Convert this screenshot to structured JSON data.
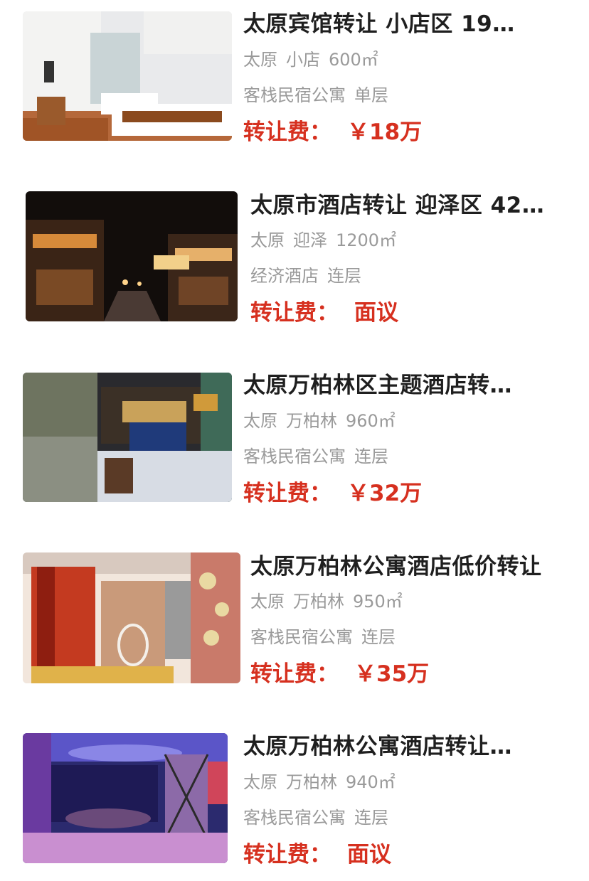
{
  "listings": [
    {
      "title": "太原宾馆转让 小店区 19…",
      "city": "太原",
      "district": "小店",
      "area": "600㎡",
      "category": "客栈民宿公寓",
      "floors": "单层",
      "price_label": "转让费：",
      "price": "￥18万",
      "thumb": "hotel-room-twin-beds"
    },
    {
      "title": "太原市酒店转让 迎泽区 42…",
      "city": "太原",
      "district": "迎泽",
      "area": "1200㎡",
      "category": "经济酒店",
      "floors": "连层",
      "price_label": "转让费：",
      "price": "面议",
      "thumb": "night-street-storefronts"
    },
    {
      "title": "太原万柏林区主题酒店转…",
      "city": "太原",
      "district": "万柏林",
      "area": "960㎡",
      "category": "客栈民宿公寓",
      "floors": "连层",
      "price_label": "转让费：",
      "price": "￥32万",
      "thumb": "theme-hotel-lobby"
    },
    {
      "title": "太原万柏林公寓酒店低价转让",
      "city": "太原",
      "district": "万柏林",
      "area": "950㎡",
      "category": "客栈民宿公寓",
      "floors": "连层",
      "price_label": "转让费：",
      "price": "￥35万",
      "thumb": "red-curtain-room-hanging-chair"
    },
    {
      "title": "太原万柏林公寓酒店转让…",
      "city": "太原",
      "district": "万柏林",
      "area": "940㎡",
      "category": "客栈民宿公寓",
      "floors": "连层",
      "price_label": "转让费：",
      "price": "面议",
      "thumb": "purple-lit-theme-room"
    }
  ]
}
